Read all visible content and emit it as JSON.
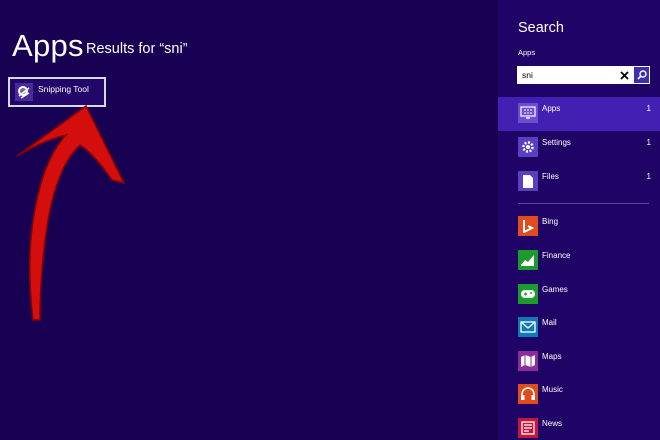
{
  "header": {
    "title": "Apps",
    "results_for": "Results for “sni”"
  },
  "results": [
    {
      "label": "Snipping Tool",
      "icon": "snipping-tool-icon"
    }
  ],
  "search_pane": {
    "title": "Search",
    "scope": "Apps",
    "query": "sni",
    "categories": [
      {
        "label": "Apps",
        "count": "1",
        "icon": "apps-monitor-icon",
        "selected": true
      },
      {
        "label": "Settings",
        "count": "1",
        "icon": "settings-gear-icon"
      },
      {
        "label": "Files",
        "count": "1",
        "icon": "file-icon"
      }
    ],
    "apps": [
      {
        "label": "Bing",
        "icon": "bing-icon",
        "color": "#e04c1c"
      },
      {
        "label": "Finance",
        "icon": "finance-chart-icon",
        "color": "#1e9b2e"
      },
      {
        "label": "Games",
        "icon": "games-controller-icon",
        "color": "#1e9b2e"
      },
      {
        "label": "Mail",
        "icon": "mail-envelope-icon",
        "color": "#0e79b6"
      },
      {
        "label": "Maps",
        "icon": "maps-icon",
        "color": "#8c2d9c"
      },
      {
        "label": "Music",
        "icon": "music-headphones-icon",
        "color": "#e04c1c"
      },
      {
        "label": "News",
        "icon": "news-icon",
        "color": "#c3183c"
      }
    ]
  },
  "colors": {
    "background": "#180052",
    "pane": "#200366",
    "selected": "#4320b4",
    "arrow": "#d40d0d"
  }
}
